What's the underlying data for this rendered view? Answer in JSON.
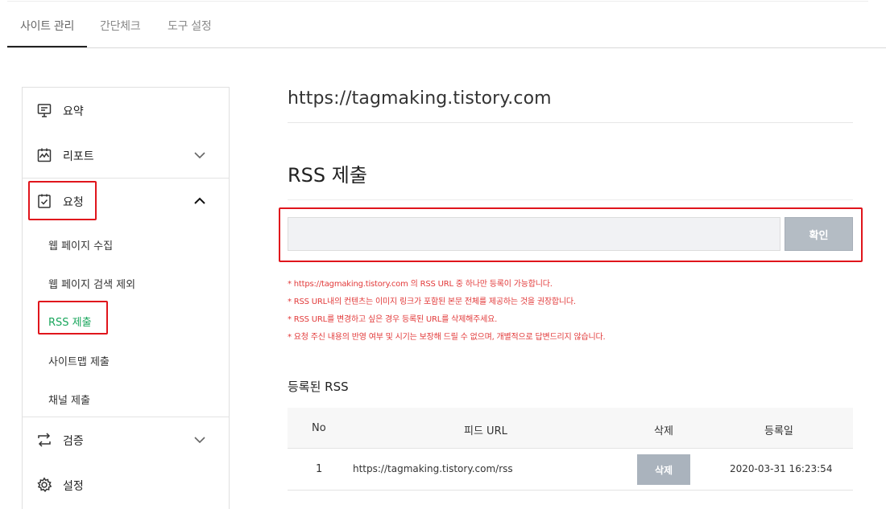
{
  "tabs": [
    {
      "label": "사이트 관리"
    },
    {
      "label": "간단체크"
    },
    {
      "label": "도구 설정"
    }
  ],
  "sidebar": {
    "items": [
      {
        "label": "요약",
        "icon": "summary-icon"
      },
      {
        "label": "리포트",
        "icon": "report-icon"
      },
      {
        "label": "요청",
        "icon": "request-icon"
      },
      {
        "label": "검증",
        "icon": "verify-icon"
      },
      {
        "label": "설정",
        "icon": "settings-icon"
      }
    ],
    "request_sub": [
      {
        "label": "웹 페이지 수집"
      },
      {
        "label": "웹 페이지 검색 제외"
      },
      {
        "label": "RSS 제출"
      },
      {
        "label": "사이트맵 제출"
      },
      {
        "label": "채널 제출"
      }
    ]
  },
  "main": {
    "site_url": "https://tagmaking.tistory.com",
    "section_title": "RSS 제출",
    "input_value": "",
    "confirm_label": "확인",
    "notes": [
      "* https://tagmaking.tistory.com 의 RSS URL 중 하나만 등록이 가능합니다.",
      "* RSS URL내의 컨텐츠는 이미지 링크가 포함된 본문 전체를 제공하는 것을 권장합니다.",
      "* RSS URL를 변경하고 싶은 경우 등록된 URL를 삭제해주세요.",
      "* 요청 주신 내용의 반영 여부 및 시기는 보장해 드릴 수 없으며, 개별적으로 답변드리지 않습니다."
    ],
    "registered_title": "등록된 RSS",
    "table": {
      "headers": {
        "no": "No",
        "feed": "피드 URL",
        "delete": "삭제",
        "date": "등록일"
      },
      "rows": [
        {
          "no": "1",
          "feed": "https://tagmaking.tistory.com/rss",
          "delete_label": "삭제",
          "date": "2020-03-31 16:23:54"
        }
      ]
    }
  },
  "colors": {
    "accent_green": "#19a65c",
    "highlight_red": "#e0151c",
    "note_red": "#e23a3a",
    "button_gray": "#b4bcc4"
  }
}
